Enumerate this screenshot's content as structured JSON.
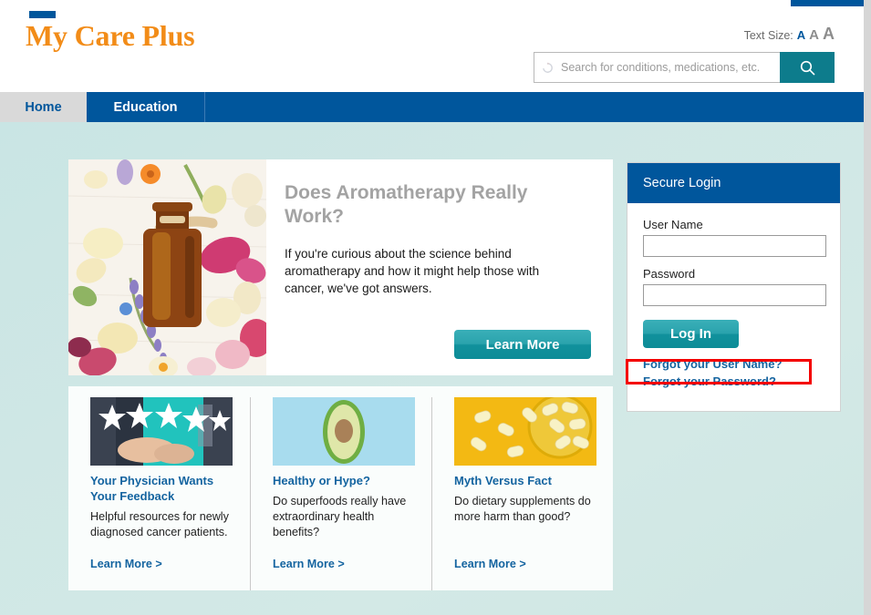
{
  "brand": {
    "name": "My Care Plus",
    "accent_blue": "#00569c",
    "accent_orange": "#f28c18",
    "accent_teal": "#0d8c97"
  },
  "header": {
    "text_size_label": "Text Size:",
    "text_size_options": [
      "A",
      "A",
      "A"
    ],
    "search": {
      "placeholder": "Search for conditions, medications, etc.",
      "value": "",
      "button_icon": "search-icon",
      "leading_icon": "loading-spinner-icon"
    }
  },
  "nav": {
    "items": [
      {
        "label": "Home",
        "active": false
      },
      {
        "label": "Education",
        "active": true
      }
    ]
  },
  "hero": {
    "title": "Does Aromatherapy Really Work?",
    "description": "If you're curious about the science behind aromatherapy and how it might help those with cancer, we've got answers.",
    "cta_label": "Learn More",
    "image_alt": "essential-oil-bottle-with-dried-flowers"
  },
  "cards": [
    {
      "title": "Your Physician Wants Your Feedback",
      "description": "Helpful resources for newly diagnosed cancer patients.",
      "link_label": "Learn More >",
      "image_alt": "five-star-rating-over-clinician-hand"
    },
    {
      "title": "Healthy or Hype?",
      "description": "Do superfoods really have extraordinary health benefits?",
      "link_label": "Learn More >",
      "image_alt": "halved-avocado-on-blue-background"
    },
    {
      "title": "Myth Versus Fact",
      "description": "Do dietary supplements do more harm than good?",
      "link_label": "Learn More >",
      "image_alt": "supplement-capsules-in-bowl-on-yellow-background"
    }
  ],
  "login": {
    "heading": "Secure Login",
    "username_label": "User Name",
    "username_value": "",
    "password_label": "Password",
    "password_value": "",
    "submit_label": "Log In",
    "forgot_username_label": "Forgot your User Name?",
    "forgot_password_label": "Forgot your Password?"
  },
  "annotation": {
    "highlight_color": "#f40000",
    "highlight_target": "forgot-username-link"
  }
}
